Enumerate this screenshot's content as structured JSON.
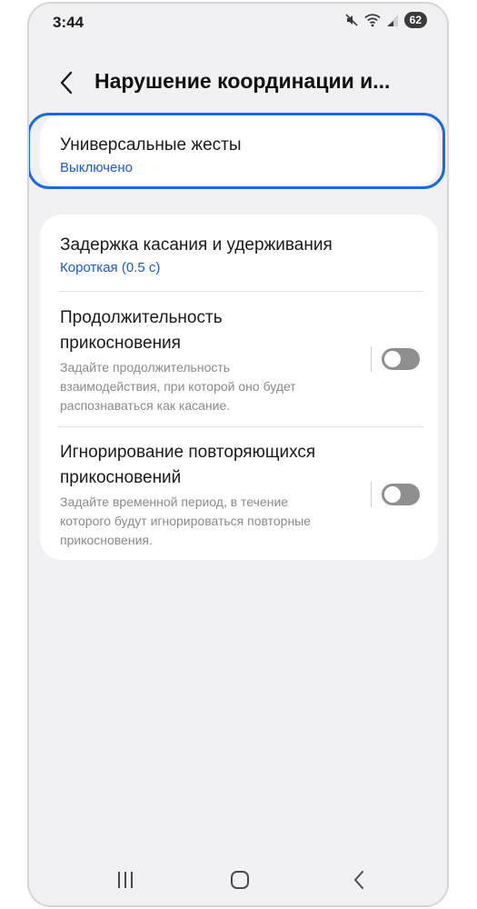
{
  "status_bar": {
    "time": "3:44",
    "battery": "62",
    "icons": [
      "mute-icon",
      "wifi-icon",
      "signal-icon",
      "battery-icon"
    ]
  },
  "header": {
    "title": "Нарушение координации и...",
    "back_icon": "back-arrow-icon"
  },
  "settings": {
    "universal_gestures": {
      "title": "Универсальные жесты",
      "value": "Выключено"
    },
    "touch_hold_delay": {
      "title": "Задержка касания и удерживания",
      "value": "Короткая (0.5 с)"
    },
    "tap_duration": {
      "title_line1": "Продолжительность",
      "title_line2": "прикосновения",
      "desc_line1": "Задайте продолжительность",
      "desc_line2": "взаимодействия, при которой оно будет",
      "desc_line3": "распознаваться как касание.",
      "enabled": false
    },
    "ignore_repeated": {
      "title_line1": "Игнорирование повторяющихся",
      "title_line2": "прикосновений",
      "desc_line1": "Задайте временной период, в течение",
      "desc_line2": "которого будут игнорироваться повторные",
      "desc_line3": "прикосновения.",
      "enabled": false
    }
  },
  "colors": {
    "accent": "#1a5bd6",
    "highlight": "#1769e6",
    "background": "#f1f1f3",
    "card": "#ffffff",
    "toggle_off": "#8f8f92"
  },
  "nav_bar": {
    "icons": [
      "recent-apps-icon",
      "home-icon",
      "back-icon"
    ]
  }
}
